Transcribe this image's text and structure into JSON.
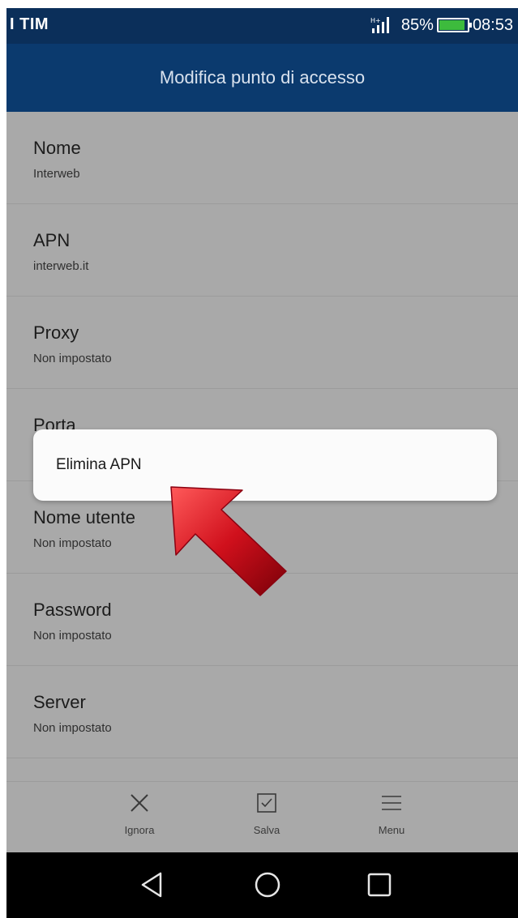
{
  "status_bar": {
    "carrier": "I TIM",
    "battery_percent": "85%",
    "battery_level": 0.85,
    "time": "08:53",
    "icons": [
      "signal-icon",
      "battery-icon"
    ]
  },
  "app_bar": {
    "title": "Modifica punto di accesso"
  },
  "preferences": [
    {
      "title": "Nome",
      "value": "Interweb"
    },
    {
      "title": "APN",
      "value": "interweb.it"
    },
    {
      "title": "Proxy",
      "value": "Non impostato"
    },
    {
      "title": "Porta",
      "value": ""
    },
    {
      "title": "Nome utente",
      "value": "Non impostato"
    },
    {
      "title": "Password",
      "value": "Non impostato"
    },
    {
      "title": "Server",
      "value": "Non impostato"
    }
  ],
  "popup_menu": {
    "items": [
      "Elimina APN"
    ]
  },
  "bottom_bar": {
    "ignore_label": "Ignora",
    "save_label": "Salva",
    "menu_label": "Menu",
    "icons": [
      "close-icon",
      "checkbox-icon",
      "menu-icon"
    ]
  },
  "nav_bar": {
    "icons": [
      "back-icon",
      "home-icon",
      "recents-icon"
    ]
  },
  "colors": {
    "status_bar": "#0b2f5a",
    "app_bar": "#0b3a6e",
    "dim_background": "#a9a9a9",
    "popup": "#fbfbfb",
    "arrow": "#c0141e"
  }
}
